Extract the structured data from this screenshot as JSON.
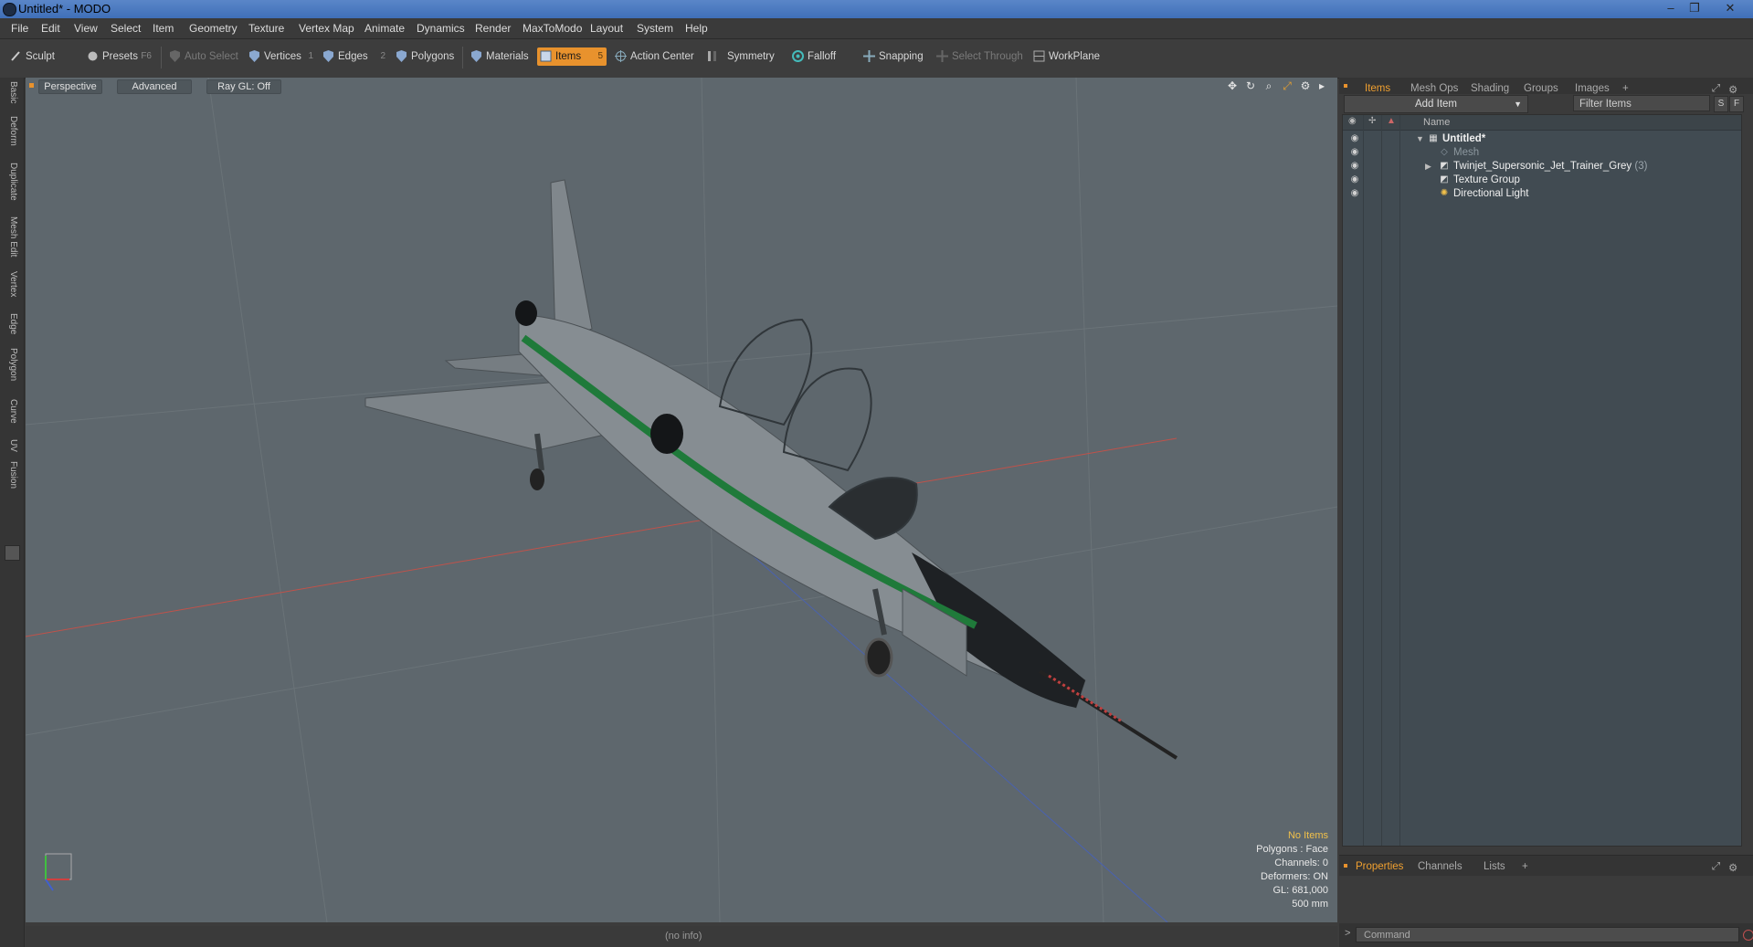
{
  "window": {
    "title": "Untitled* - MODO",
    "controls": [
      "minimize-icon",
      "restore-icon",
      "close-icon"
    ]
  },
  "menu": [
    "File",
    "Edit",
    "View",
    "Select",
    "Item",
    "Geometry",
    "Texture",
    "Vertex Map",
    "Animate",
    "Dynamics",
    "Render",
    "MaxToModo",
    "Layout",
    "System",
    "Help"
  ],
  "toolbar": {
    "sculpt": "Sculpt",
    "presets": "Presets",
    "presets_key": "F6",
    "auto_select": "Auto Select",
    "vertices": "Vertices",
    "vertices_key": "1",
    "edges": "Edges",
    "edges_key": "2",
    "polygons": "Polygons",
    "materials": "Materials",
    "items": "Items",
    "items_key": "5",
    "action_center": "Action Center",
    "symmetry": "Symmetry",
    "falloff": "Falloff",
    "snapping": "Snapping",
    "select_through": "Select Through",
    "workplane": "WorkPlane"
  },
  "left_tabs": [
    "Basic",
    "Deform",
    "Duplicate",
    "Mesh Edit",
    "Vertex",
    "Edge",
    "Polygon",
    "Curve",
    "UV",
    "Fusion"
  ],
  "viewport": {
    "view_mode": "Perspective",
    "shading": "Advanced",
    "raygl": "Ray GL: Off",
    "info": {
      "no_items": "No Items",
      "polygons": "Polygons : Face",
      "channels": "Channels: 0",
      "deformers": "Deformers: ON",
      "gl": "GL: 681,000",
      "scale": "500 mm"
    }
  },
  "status": {
    "text": "(no info)"
  },
  "right_panel": {
    "tabs": [
      "Items",
      "Mesh Ops",
      "Shading",
      "Groups",
      "Images"
    ],
    "add_item": "Add Item",
    "filter_placeholder": "Filter Items",
    "btn_s": "S",
    "btn_f": "F",
    "col_name": "Name",
    "items": [
      {
        "label": "Untitled*",
        "bold": true,
        "dim": false,
        "count": ""
      },
      {
        "label": "Mesh",
        "bold": false,
        "dim": true,
        "count": ""
      },
      {
        "label": "Twinjet_Supersonic_Jet_Trainer_Grey",
        "bold": false,
        "dim": false,
        "count": "(3)"
      },
      {
        "label": "Texture Group",
        "bold": false,
        "dim": false,
        "count": ""
      },
      {
        "label": "Directional Light",
        "bold": false,
        "dim": false,
        "count": ""
      }
    ],
    "bottom_tabs": [
      "Properties",
      "Channels",
      "Lists"
    ],
    "command_placeholder": "Command"
  },
  "colors": {
    "accent": "#e8922d",
    "viewport_bg": "#5e676d",
    "jet_stripe": "#1f7a3a"
  }
}
